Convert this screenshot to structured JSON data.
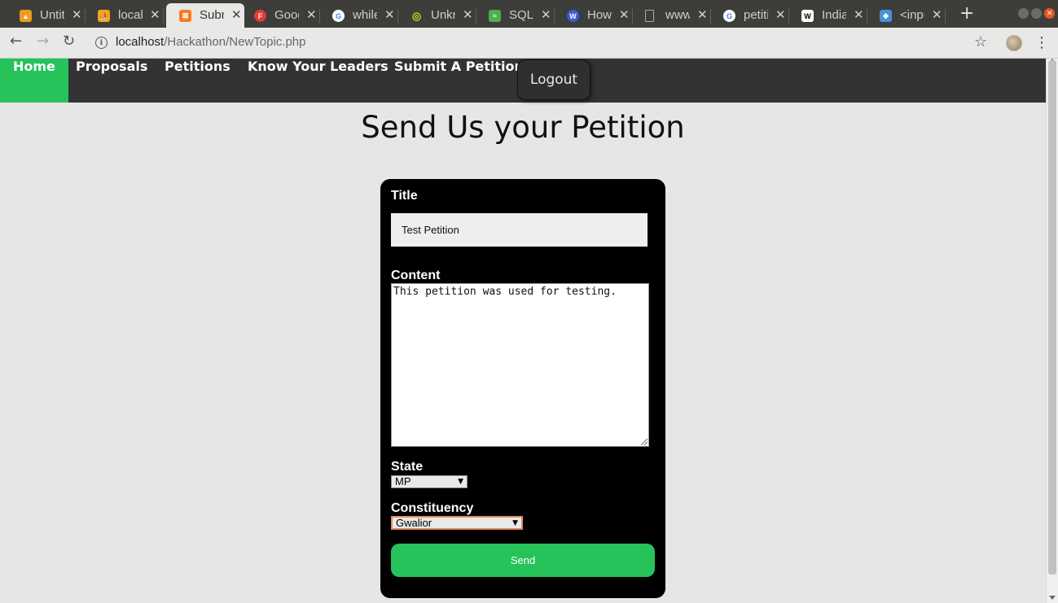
{
  "browser": {
    "tabs": [
      {
        "title": "Untitled",
        "icon": "untitled-icon",
        "color": "#f19a1d"
      },
      {
        "title": "localhost",
        "icon": "phpmyadmin-icon",
        "color": "#f2a51a"
      },
      {
        "title": "Submit",
        "icon": "xampp-icon",
        "color": "#fb7a24",
        "active": true
      },
      {
        "title": "Google Fonts",
        "icon": "google-fonts-icon",
        "color": "#e53935"
      },
      {
        "title": "while",
        "icon": "google-icon",
        "color": "#4285f4"
      },
      {
        "title": "Unknown",
        "icon": "unknown-icon",
        "color": "#d6d226"
      },
      {
        "title": "SQL",
        "icon": "sql-icon",
        "color": "#4caf50"
      },
      {
        "title": "How",
        "icon": "wikihow-icon",
        "color": "#3b5bdb"
      },
      {
        "title": "www",
        "icon": "file-icon",
        "color": "#bdbdbd"
      },
      {
        "title": "petition",
        "icon": "google-icon",
        "color": "#4285f4"
      },
      {
        "title": "India",
        "icon": "wikipedia-icon",
        "color": "#ffffff"
      },
      {
        "title": "<input",
        "icon": "input-icon",
        "color": "#4a90d9"
      }
    ],
    "url_host": "localhost",
    "url_path": "/Hackathon/NewTopic.php"
  },
  "nav": {
    "items": [
      "Home",
      "Proposals",
      "Petitions",
      "Know Your Leaders",
      "Submit A Petition"
    ],
    "logout": "Logout",
    "accent": "#26c25a",
    "background": "#333333"
  },
  "page": {
    "heading": "Send Us your Petition"
  },
  "form": {
    "title_label": "Title",
    "title_value": "Test Petition",
    "content_label": "Content",
    "content_value": "This petition was used for testing.",
    "state_label": "State",
    "state_value": "MP",
    "constituency_label": "Constituency",
    "constituency_value": "Gwalior",
    "send_label": "Send",
    "send_color": "#26c25a"
  }
}
